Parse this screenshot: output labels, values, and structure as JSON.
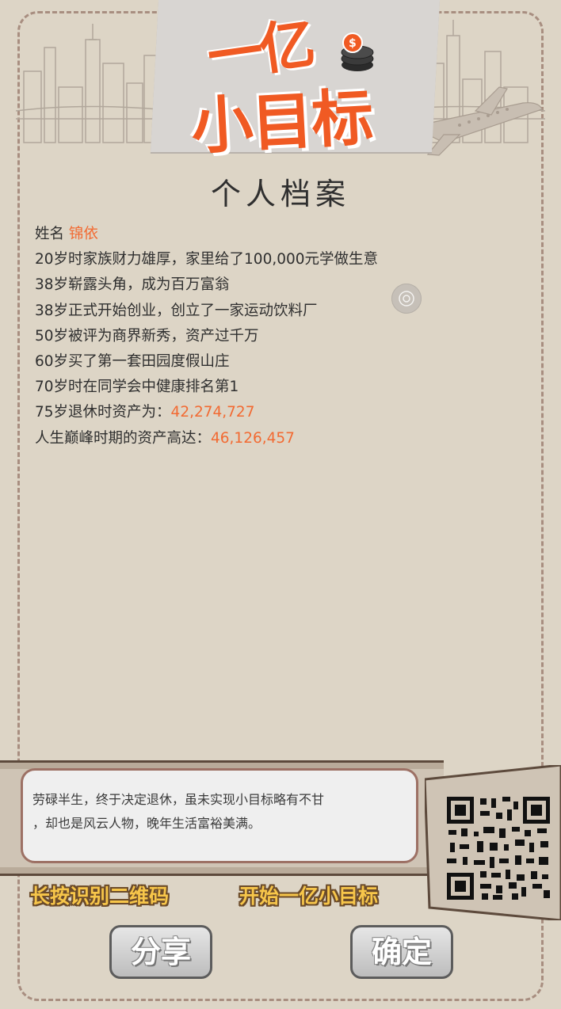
{
  "logo": {
    "line1": "一亿",
    "line2": "小目标"
  },
  "title": "个人档案",
  "profile": {
    "name_label": "姓名",
    "name_value": "锦依",
    "events": [
      "20岁时家族财力雄厚，家里给了100,000元学做生意",
      "38岁崭露头角，成为百万富翁",
      "38岁正式开始创业，创立了一家运动饮料厂",
      "50岁被评为商界新秀，资产过千万",
      "60岁买了第一套田园度假山庄",
      "70岁时在同学会中健康排名第1"
    ],
    "retire_label": "75岁退休时资产为：",
    "retire_value": "42,274,727",
    "peak_label": "人生巅峰时期的资产高达：",
    "peak_value": "46,126,457"
  },
  "summary": {
    "line1": "劳碌半生，终于决定退休，虽未实现小目标略有不甘",
    "line2": "，却也是风云人物，晚年生活富裕美满。"
  },
  "actions": {
    "qr_hint": "长按识别二维码",
    "start_hint": "开始一亿小目标"
  },
  "buttons": {
    "share": "分享",
    "confirm": "确定"
  },
  "colors": {
    "accent": "#f26a32",
    "background": "#ddd5c6",
    "border": "#a88e80"
  }
}
